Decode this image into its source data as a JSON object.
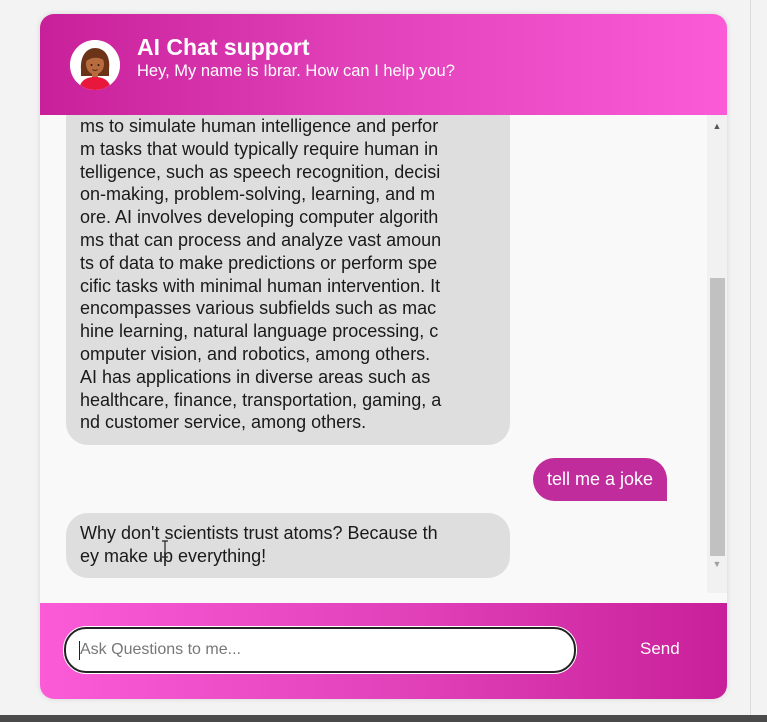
{
  "header": {
    "title": "AI Chat support",
    "subtitle": "Hey, My name is Ibrar. How can I help you?",
    "avatar_icon": "woman-avatar-icon"
  },
  "messages": [
    {
      "sender": "bot",
      "lines": [
        "ms to simulate human intelligence and perfor",
        "m tasks that would typically require human in",
        "telligence, such as speech recognition, decisi",
        "on-making, problem-solving, learning, and m",
        "ore. AI involves developing computer algorith",
        "ms that can process and analyze vast amoun",
        "ts of data to make predictions or perform spe",
        "cific tasks with minimal human intervention. It",
        "encompasses various subfields such as mac",
        "hine learning, natural language processing, c",
        "omputer vision, and robotics, among others.",
        "AI has applications in diverse areas such as",
        "healthcare, finance, transportation, gaming, a",
        "nd customer service, among others."
      ]
    },
    {
      "sender": "user",
      "text": "tell me a joke"
    },
    {
      "sender": "bot",
      "lines": [
        "Why don't scientists trust atoms? Because th",
        "ey make up everything!"
      ]
    }
  ],
  "footer": {
    "input_placeholder": "Ask Questions to me...",
    "input_value": "",
    "send_label": "Send"
  },
  "colors": {
    "header_gradient_start": "#c8209a",
    "header_gradient_end": "#fb5bd7",
    "user_bubble": "#c02c9c",
    "bot_bubble": "#dedede"
  }
}
